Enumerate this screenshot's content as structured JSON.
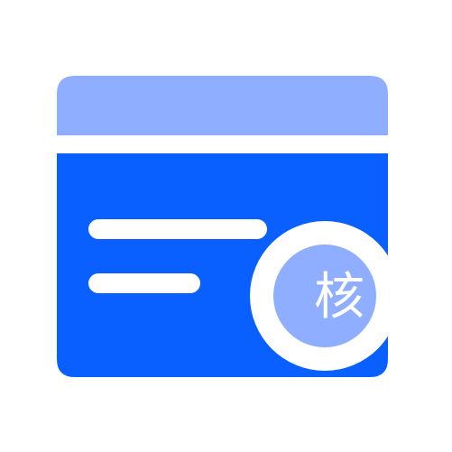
{
  "icon": {
    "name": "verification-card-icon",
    "badge_label": "核",
    "colors": {
      "card_header": "#8FAEFF",
      "card_body": "#0A5FFF",
      "text_lines": "#FFFFFF",
      "badge_fill": "#8FAEFF",
      "badge_ring": "#FFFFFF",
      "badge_text": "#FFFFFF",
      "background": "#FFFFFF"
    }
  }
}
